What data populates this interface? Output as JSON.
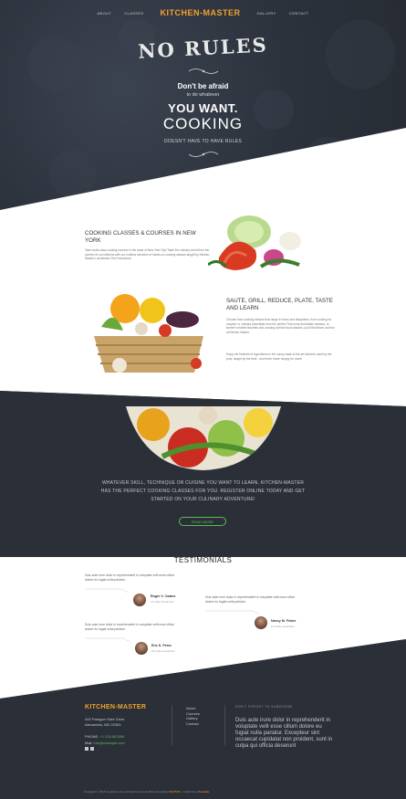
{
  "nav": {
    "items_left": [
      "About",
      "Classes"
    ],
    "logo": "KITCHEN-MASTER",
    "items_right": [
      "Gallery",
      "Contact"
    ]
  },
  "hero": {
    "headline": "NO RULES",
    "line1": "Don't be afraid",
    "line2": "to do whatever",
    "line3": "YOU WANT.",
    "line4": "COOKING",
    "line5": "DOESN'T HAVE TO HAVE RULES"
  },
  "section1": {
    "title": "COOKING CLASSES & COURSES IN NEW YORK",
    "text": "Take world-class cooking courses in the heart of New York City! Taste the culinary world from the comfort of our kitchens with our endless selection of hands-on cooking classes taught by Kitchen-Master's acclaimed Chef Instructors."
  },
  "section2": {
    "title": "SAUTE, GRILL, REDUCE, PLATE, TASTE AND LEARN",
    "text1": "Choose from cooking classes that range in focus and disciplines, from cooking for couples' or culinary essentials from the perfect Thai curry and Italian classics, to farmer's market favorites and cooking comfort food classics, you'll find flavor and fun at Kitchen-Master.",
    "text2": "Enjoy the freshest of ingredients in the sunny state-of-the-art kitchens used by the pros, taught by the best - and never leave hungry for more!"
  },
  "dark": {
    "text": "WHATEVER SKILL, TECHNIQUE OR CUISINE YOU WANT TO LEARN, KITCHEN-MASTER HAS THE PERFECT COOKING CLASSES FOR YOU. REGISTER ONLINE TODAY AND GET STARTED ON YOUR CULINARY ADVENTURE!",
    "button": "READ MORE"
  },
  "testimonials": {
    "title": "TESTIMONIALS",
    "items": [
      {
        "quote": "Duis aute irure dolor in reprehenderit in voluptate velit esse cillum dolore eu fugiat nulla pariatur.",
        "name": "Roger V. Coates",
        "role": "21 visits via kitchen"
      },
      {
        "quote": "Duis aute irure dolor in reprehenderit in voluptate velit esse cillum dolore eu fugiat nulla pariatur.",
        "name": "Nancy M. Fisher",
        "role": "14 visits via kitchen"
      },
      {
        "quote": "Duis aute irure dolor in reprehenderit in voluptate velit esse cillum dolore eu fugiat nulla pariatur.",
        "name": "Eric K. Pérez",
        "role": "18 visits via kitchen"
      }
    ]
  },
  "footer": {
    "logo": "KITCHEN-MASTER",
    "address1": "440 Paragon Gate Drive,",
    "address2": "Alexandria, MD 22304",
    "phone_label": "PHONE:",
    "phone": "+1 234 567890",
    "mail_label": "Mail:",
    "mail": "info@example.com",
    "links": [
      "About",
      "Courses",
      "Gallery",
      "Contact"
    ],
    "subscribe_label": "Don't forget to subscribe",
    "subscribe_text": "Duis aute irure dolor in reprehenderit in voluptate velit esse cillum dolore eu fugiat nulla pariatur. Excepteur sint occaecat cupidatat non proident, sunt in culpa qui officia deserunt",
    "copyright": "Copyright © 2015 Company name All rights reserved More Templates",
    "copyright_hl": "PHOTOS",
    "copyright_tail": "- Collect from",
    "copyright_hl2": "Template"
  },
  "colors": {
    "accent": "#f2a22c",
    "green": "#5dbb53",
    "dark": "#2b3038"
  }
}
